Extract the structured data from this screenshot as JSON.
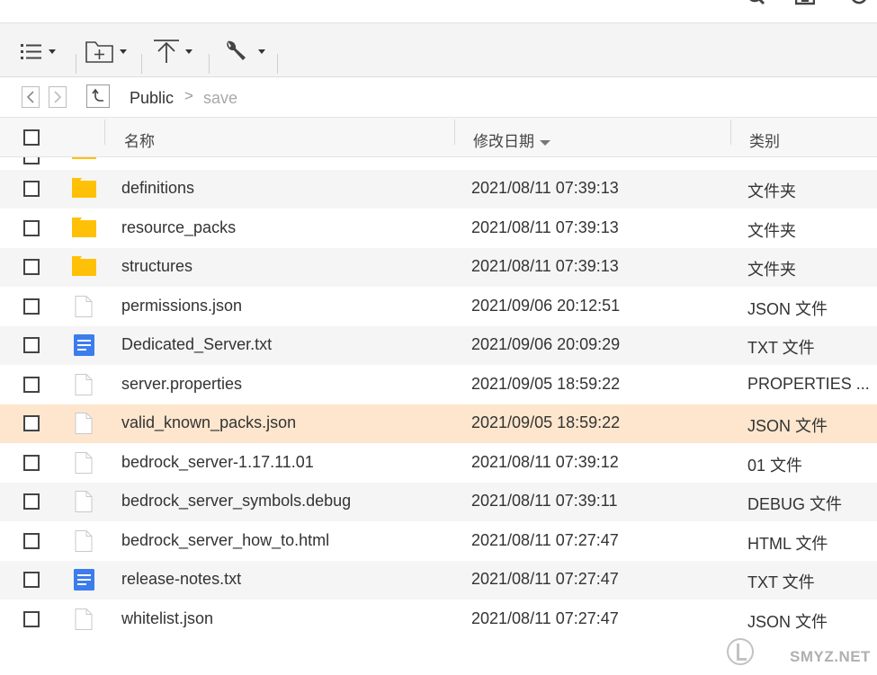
{
  "breadcrumb": {
    "root": "Public",
    "sep": ">",
    "current": "save"
  },
  "columns": {
    "name": "名称",
    "date": "修改日期",
    "type": "类别"
  },
  "rows": [
    {
      "name": "definitions",
      "date": "2021/08/11 07:39:13",
      "type": "文件夹",
      "icon": "folder-icon"
    },
    {
      "name": "resource_packs",
      "date": "2021/08/11 07:39:13",
      "type": "文件夹",
      "icon": "folder-icon"
    },
    {
      "name": "structures",
      "date": "2021/08/11 07:39:13",
      "type": "文件夹",
      "icon": "folder-icon"
    },
    {
      "name": "permissions.json",
      "date": "2021/09/06 20:12:51",
      "type": "JSON 文件",
      "icon": "file-icon"
    },
    {
      "name": "Dedicated_Server.txt",
      "date": "2021/09/06 20:09:29",
      "type": "TXT 文件",
      "icon": "text-document-icon"
    },
    {
      "name": "server.properties",
      "date": "2021/09/05 18:59:22",
      "type": "PROPERTIES ...",
      "icon": "file-icon"
    },
    {
      "name": "valid_known_packs.json",
      "date": "2021/09/05 18:59:22",
      "type": "JSON 文件",
      "icon": "file-icon",
      "selected": true
    },
    {
      "name": "bedrock_server-1.17.11.01",
      "date": "2021/08/11 07:39:12",
      "type": "01 文件",
      "icon": "file-icon"
    },
    {
      "name": "bedrock_server_symbols.debug",
      "date": "2021/08/11 07:39:11",
      "type": "DEBUG 文件",
      "icon": "file-icon"
    },
    {
      "name": "bedrock_server_how_to.html",
      "date": "2021/08/11 07:27:47",
      "type": "HTML 文件",
      "icon": "file-icon"
    },
    {
      "name": "release-notes.txt",
      "date": "2021/08/11 07:27:47",
      "type": "TXT 文件",
      "icon": "text-document-icon"
    },
    {
      "name": "whitelist.json",
      "date": "2021/08/11 07:27:47",
      "type": "JSON 文件",
      "icon": "file-icon"
    }
  ],
  "watermark": {
    "text": "SMYZ.NET"
  },
  "colors": {
    "folder": "#ffc107",
    "text_doc": "#3b7ded",
    "selected_row": "#fde6cd",
    "alt_row": "#f5f5f5"
  }
}
